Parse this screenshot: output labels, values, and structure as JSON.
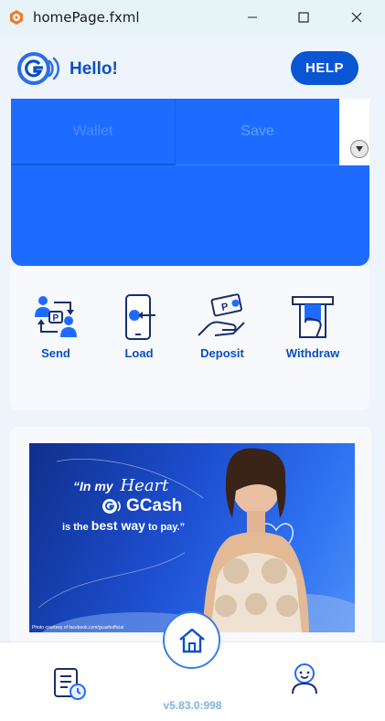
{
  "window": {
    "title": "homePage.fxml",
    "icons": {
      "app": "app-logo-icon",
      "minimize": "minimize-icon",
      "maximize": "maximize-icon",
      "close": "close-icon"
    }
  },
  "header": {
    "greeting": "Hello!",
    "help_label": "HELP",
    "logo_icon": "gcash-logo-icon"
  },
  "balance": {
    "tabs": [
      {
        "label": "Wallet"
      },
      {
        "label": "Save"
      }
    ],
    "dropdown_icon": "chevron-down-icon"
  },
  "services": [
    {
      "label": "Send",
      "icon": "send-money-icon"
    },
    {
      "label": "Load",
      "icon": "load-phone-icon"
    },
    {
      "label": "Deposit",
      "icon": "deposit-cash-icon"
    },
    {
      "label": "Withdraw",
      "icon": "withdraw-atm-icon"
    }
  ],
  "promo": {
    "quote_start": "“In my",
    "quote_script": "Heart",
    "brand": "GCash",
    "quote_end_prefix": "is the",
    "quote_end_emphasis": "best way",
    "quote_end_suffix": "to pay.”",
    "credit": "Photo courtesy of facebook.com/gcashofficial"
  },
  "nav": {
    "home_icon": "home-icon",
    "history_icon": "transaction-history-icon",
    "profile_icon": "profile-icon",
    "version": "v5.83.0:998"
  },
  "colors": {
    "brand_blue": "#0a55d4",
    "card_blue": "#1e6cff",
    "background": "#eef4fb",
    "version_text": "#7db3e8"
  }
}
